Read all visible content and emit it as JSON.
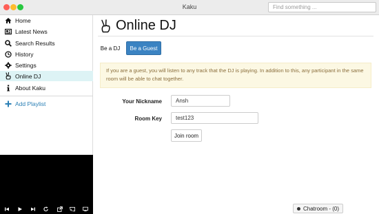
{
  "window": {
    "title": "Kaku",
    "search_placeholder": "Find something ..."
  },
  "sidebar": {
    "items": [
      {
        "label": "Home",
        "icon": "home-icon"
      },
      {
        "label": "Latest News",
        "icon": "news-icon"
      },
      {
        "label": "Search Results",
        "icon": "search-icon"
      },
      {
        "label": "History",
        "icon": "history-icon"
      },
      {
        "label": "Settings",
        "icon": "gear-icon"
      },
      {
        "label": "Online DJ",
        "icon": "hand-peace-icon",
        "active": true
      },
      {
        "label": "About Kaku",
        "icon": "info-icon"
      }
    ],
    "add_playlist_label": "Add Playlist"
  },
  "player": {
    "controls": [
      "previous-icon",
      "play-icon",
      "next-icon",
      "repeat-icon",
      "external-link-icon",
      "cast-icon",
      "monitor-icon"
    ]
  },
  "main": {
    "title": "Online DJ",
    "tabs": [
      {
        "label": "Be a DJ",
        "active": false
      },
      {
        "label": "Be a Guest",
        "active": true
      }
    ],
    "notice": "If you are a guest, you will listen to any track that the DJ is playing. In addition to this, any participant in the same room will be able to chat together.",
    "form": {
      "nickname_label": "Your Nickname",
      "nickname_value": "Ansh",
      "room_label": "Room Key",
      "room_value": "test123",
      "join_label": "Join room"
    },
    "chatroom_label": "Chatroom - (0)"
  },
  "colors": {
    "accent": "#3b83c2",
    "active_nav_bg": "#ddf3f5",
    "notice_bg": "#fcf8e3",
    "notice_text": "#8a6d3b",
    "link": "#2a7fb5"
  }
}
